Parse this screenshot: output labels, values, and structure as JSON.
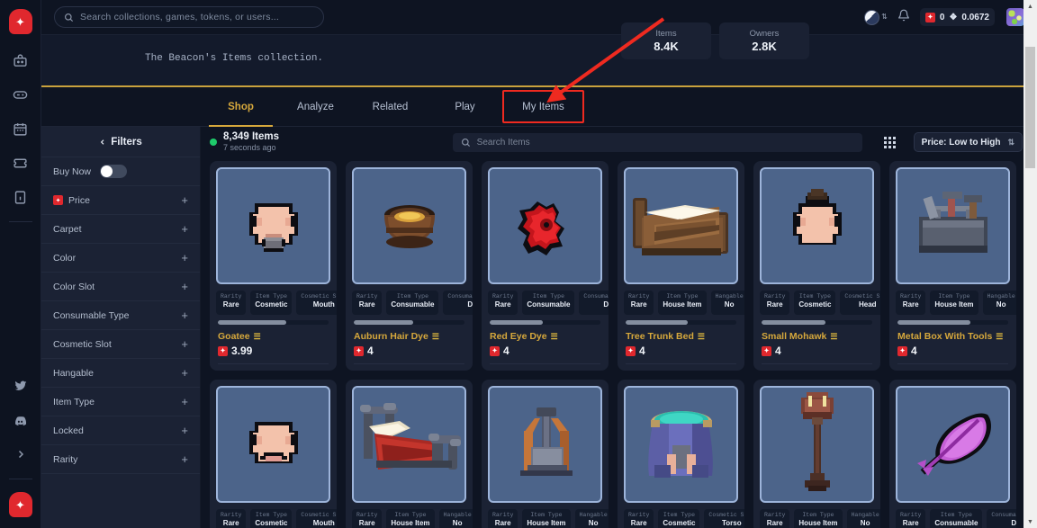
{
  "rail": {
    "logo": "sparkle-logo",
    "items": [
      {
        "name": "bag-icon"
      },
      {
        "name": "controller-icon"
      },
      {
        "name": "calendar-icon"
      },
      {
        "name": "ticket-icon"
      },
      {
        "name": "document-icon"
      }
    ],
    "social": [
      {
        "name": "twitter-icon"
      },
      {
        "name": "discord-icon"
      },
      {
        "name": "chevron-right-icon"
      }
    ]
  },
  "topbar": {
    "search_placeholder": "Search collections, games, tokens, or users...",
    "chain_symbol": "◩",
    "wallet": {
      "points": "0",
      "balance": "0.0672",
      "eth_glyph": "❖"
    }
  },
  "collection": {
    "description": "The Beacon's Items collection.",
    "stats": [
      {
        "key": "Items",
        "value": "8.4K"
      },
      {
        "key": "Owners",
        "value": "2.8K"
      }
    ]
  },
  "tabs": [
    {
      "label": "Shop",
      "active": true
    },
    {
      "label": "Analyze",
      "active": false
    },
    {
      "label": "Related",
      "active": false
    },
    {
      "label": "Play",
      "active": false
    },
    {
      "label": "My Items",
      "active": false,
      "highlighted": true
    }
  ],
  "filters": {
    "title": "Filters",
    "back_icon": "chevron-left-icon",
    "buy_now": {
      "label": "Buy Now",
      "enabled": false
    },
    "rows": [
      {
        "label": "Price",
        "badge": true
      },
      {
        "label": "Carpet"
      },
      {
        "label": "Color"
      },
      {
        "label": "Color Slot"
      },
      {
        "label": "Consumable Type"
      },
      {
        "label": "Cosmetic Slot"
      },
      {
        "label": "Hangable"
      },
      {
        "label": "Item Type"
      },
      {
        "label": "Locked"
      },
      {
        "label": "Rarity"
      }
    ],
    "expand_symbol": "+"
  },
  "toolbar": {
    "item_count": "8,349 Items",
    "updated": "7 seconds ago",
    "search_placeholder": "Search Items",
    "grid_icon": "grid-view-icon",
    "sort_label": "Price: Low to High",
    "sort_caret": "⇅"
  },
  "cards": [
    {
      "name": "Goatee",
      "price": "3.99",
      "progress": 62,
      "badges": [
        {
          "k": "Rarity",
          "v": "Rare"
        },
        {
          "k": "Item Type",
          "v": "Cosmetic"
        },
        {
          "k": "Cosmetic Slot",
          "v": "Mouth"
        }
      ],
      "sprite": "goatee"
    },
    {
      "name": "Auburn Hair Dye",
      "price": "4",
      "progress": 54,
      "badges": [
        {
          "k": "Rarity",
          "v": "Rare"
        },
        {
          "k": "Item Type",
          "v": "Consumable"
        },
        {
          "k": "Consumable Type",
          "v": "Dye"
        }
      ],
      "sprite": "dye-pot"
    },
    {
      "name": "Red Eye Dye",
      "price": "4",
      "progress": 48,
      "badges": [
        {
          "k": "Rarity",
          "v": "Rare"
        },
        {
          "k": "Item Type",
          "v": "Consumable"
        },
        {
          "k": "Consumable Type",
          "v": "Dye"
        }
      ],
      "sprite": "red-eye"
    },
    {
      "name": "Tree Trunk Bed",
      "price": "4",
      "progress": 56,
      "badges": [
        {
          "k": "Rarity",
          "v": "Rare"
        },
        {
          "k": "Item Type",
          "v": "House Item"
        },
        {
          "k": "Hangable",
          "v": "No"
        }
      ],
      "sprite": "tree-bed"
    },
    {
      "name": "Small Mohawk",
      "price": "4",
      "progress": 58,
      "badges": [
        {
          "k": "Rarity",
          "v": "Rare"
        },
        {
          "k": "Item Type",
          "v": "Cosmetic"
        },
        {
          "k": "Cosmetic Slot",
          "v": "Head"
        }
      ],
      "sprite": "mohawk"
    },
    {
      "name": "Metal Box With Tools",
      "price": "4",
      "progress": 66,
      "badges": [
        {
          "k": "Rarity",
          "v": "Rare"
        },
        {
          "k": "Item Type",
          "v": "House Item"
        },
        {
          "k": "Hangable",
          "v": "No"
        }
      ],
      "sprite": "toolbox"
    },
    {
      "name": "",
      "price": "",
      "progress": 0,
      "badges": [
        {
          "k": "Rarity",
          "v": "Rare"
        },
        {
          "k": "Item Type",
          "v": "Cosmetic"
        },
        {
          "k": "Cosmetic Slot",
          "v": "Mouth"
        }
      ],
      "sprite": "frown"
    },
    {
      "name": "",
      "price": "",
      "progress": 0,
      "badges": [
        {
          "k": "Rarity",
          "v": "Rare"
        },
        {
          "k": "Item Type",
          "v": "House Item"
        },
        {
          "k": "Hangable",
          "v": "No"
        }
      ],
      "sprite": "red-bed"
    },
    {
      "name": "",
      "price": "",
      "progress": 0,
      "badges": [
        {
          "k": "Rarity",
          "v": "Rare"
        },
        {
          "k": "Item Type",
          "v": "House Item"
        },
        {
          "k": "Hangable",
          "v": "No"
        }
      ],
      "sprite": "anvil"
    },
    {
      "name": "",
      "price": "",
      "progress": 0,
      "badges": [
        {
          "k": "Rarity",
          "v": "Rare"
        },
        {
          "k": "Item Type",
          "v": "Cosmetic"
        },
        {
          "k": "Cosmetic Slot",
          "v": "Torso"
        }
      ],
      "sprite": "robe"
    },
    {
      "name": "",
      "price": "",
      "progress": 0,
      "badges": [
        {
          "k": "Rarity",
          "v": "Rare"
        },
        {
          "k": "Item Type",
          "v": "House Item"
        },
        {
          "k": "Hangable",
          "v": "No"
        }
      ],
      "sprite": "lamp"
    },
    {
      "name": "",
      "price": "",
      "progress": 0,
      "badges": [
        {
          "k": "Rarity",
          "v": "Rare"
        },
        {
          "k": "Item Type",
          "v": "Consumable"
        },
        {
          "k": "Consumable Type",
          "v": "Dye"
        }
      ],
      "sprite": "purple-feather"
    }
  ],
  "colors": {
    "accent_gold": "#d6a83c",
    "brand_red": "#e0282e",
    "annotation_red": "#ef2a20",
    "status_green": "#1ecb6b",
    "panel": "#1b2234",
    "background": "#0e1422"
  }
}
